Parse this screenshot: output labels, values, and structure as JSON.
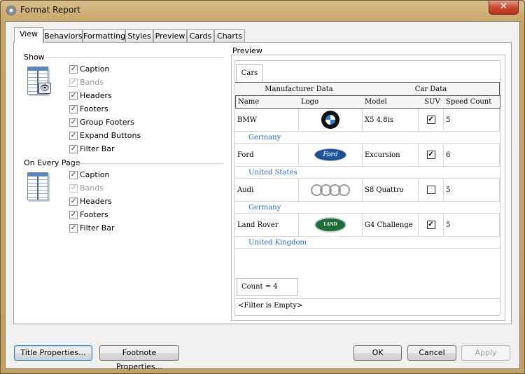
{
  "window": {
    "title": "Format Report",
    "close": "✕"
  },
  "tabs": [
    "View",
    "Behaviors",
    "Formatting",
    "Styles",
    "Preview",
    "Cards",
    "Charts"
  ],
  "show": {
    "title": "Show",
    "items": [
      {
        "label": "Caption",
        "checked": true,
        "enabled": true
      },
      {
        "label": "Bands",
        "checked": true,
        "enabled": false
      },
      {
        "label": "Headers",
        "checked": true,
        "enabled": true
      },
      {
        "label": "Footers",
        "checked": true,
        "enabled": true
      },
      {
        "label": "Group Footers",
        "checked": true,
        "enabled": true
      },
      {
        "label": "Expand Buttons",
        "checked": true,
        "enabled": true
      },
      {
        "label": "Filter Bar",
        "checked": true,
        "enabled": true
      }
    ]
  },
  "every_page": {
    "title": "On Every Page",
    "items": [
      {
        "label": "Caption",
        "checked": true,
        "enabled": true
      },
      {
        "label": "Bands",
        "checked": true,
        "enabled": false
      },
      {
        "label": "Headers",
        "checked": true,
        "enabled": true
      },
      {
        "label": "Footers",
        "checked": true,
        "enabled": true
      },
      {
        "label": "Filter Bar",
        "checked": true,
        "enabled": true
      }
    ]
  },
  "preview": {
    "title": "Preview",
    "card_tab": "Cars",
    "bands": [
      "Manufacturer Data",
      "Car Data"
    ],
    "columns": [
      "Name",
      "Logo",
      "Model",
      "SUV",
      "Speed Count"
    ],
    "rows": [
      {
        "name": "BMW",
        "logo": "bmw-logo",
        "model": "X5 4.8is",
        "suv": true,
        "speed": "5",
        "group": "Germany"
      },
      {
        "name": "Ford",
        "logo": "ford-logo",
        "model": "Excursion",
        "suv": true,
        "speed": "6",
        "group": "United States"
      },
      {
        "name": "Audi",
        "logo": "audi-logo",
        "model": "S8 Quattro",
        "suv": false,
        "speed": "5",
        "group": "Germany"
      },
      {
        "name": "Land Rover",
        "logo": "land-rover-logo",
        "model": "G4 Challenge",
        "suv": true,
        "speed": "5",
        "group": "United Kingdom"
      }
    ],
    "summary": "Count = 4",
    "filter": "<Filter is Empty>"
  },
  "buttons": {
    "title_props": "Title Properties...",
    "footnote_props": "Footnote Properties...",
    "ok": "OK",
    "cancel": "Cancel",
    "apply": "Apply"
  }
}
